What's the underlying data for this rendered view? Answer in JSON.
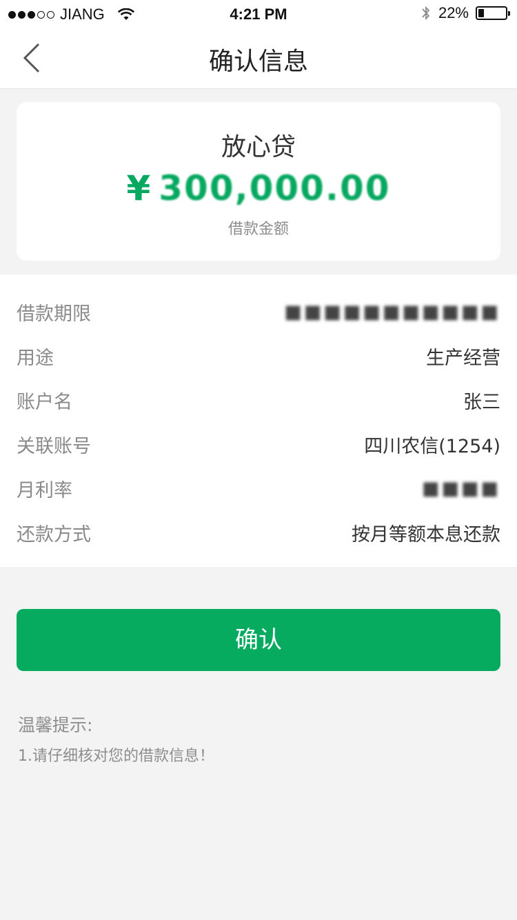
{
  "status_bar": {
    "carrier": "JIANG",
    "time": "4:21 PM",
    "battery": "22%",
    "battery_level": 0.22,
    "signal_filled": 3,
    "signal_total": 5
  },
  "nav": {
    "title": "确认信息",
    "back_icon": "chevron-left-icon"
  },
  "loan_card": {
    "product": "放心贷",
    "currency": "¥",
    "amount": "300,000.00",
    "amount_label": "借款金额"
  },
  "details": [
    {
      "label": "借款期限",
      "value": "■■■■■■■■■■■",
      "masked": true
    },
    {
      "label": "用途",
      "value": "生产经营",
      "masked": false
    },
    {
      "label": "账户名",
      "value": "张三",
      "masked": false
    },
    {
      "label": "关联账号",
      "value": "四川农信(1254)",
      "masked": false
    },
    {
      "label": "月利率",
      "value": "■■■■",
      "masked": true
    },
    {
      "label": "还款方式",
      "value": "按月等额本息还款",
      "masked": false
    }
  ],
  "confirm_button": "确认",
  "tips": {
    "title": "温馨提示:",
    "lines": [
      "1.请仔细核对您的借款信息！"
    ]
  },
  "colors": {
    "accent": "#06ab5f",
    "amount": "#07a860",
    "background": "#f3f3f3"
  }
}
